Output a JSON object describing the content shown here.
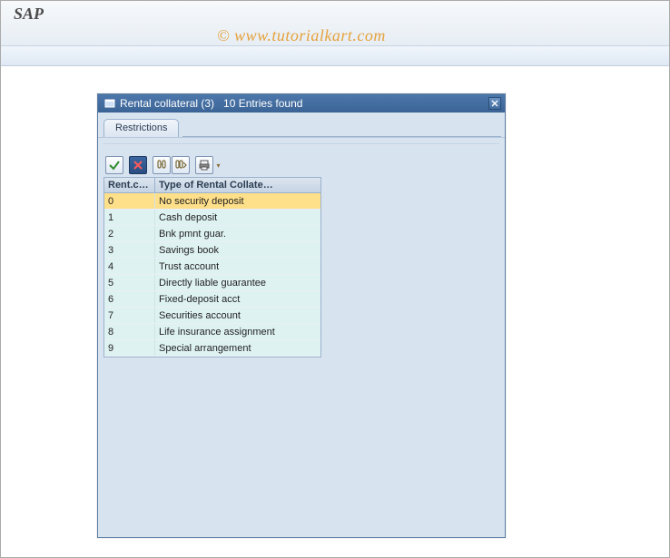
{
  "header": {
    "title": "SAP",
    "watermark": "© www.tutorialkart.com"
  },
  "dialog": {
    "title": "Rental collateral (3)",
    "subtitle": "10 Entries found",
    "close_label": "X",
    "tab_label": "Restrictions",
    "toolbar": {
      "accept": "accept",
      "cancel": "cancel",
      "find": "find",
      "find_next": "find-next",
      "print": "print"
    },
    "columns": {
      "code": "Rent.c…",
      "type": "Type of Rental Collate…"
    },
    "rows": [
      {
        "code": "0",
        "type": "No security deposit",
        "selected": true
      },
      {
        "code": "1",
        "type": "Cash deposit"
      },
      {
        "code": "2",
        "type": "Bnk pmnt guar."
      },
      {
        "code": "3",
        "type": "Savings book"
      },
      {
        "code": "4",
        "type": "Trust account"
      },
      {
        "code": "5",
        "type": "Directly liable guarantee"
      },
      {
        "code": "6",
        "type": "Fixed-deposit acct"
      },
      {
        "code": "7",
        "type": "Securities account"
      },
      {
        "code": "8",
        "type": "Life insurance assignment"
      },
      {
        "code": "9",
        "type": "Special arrangement"
      }
    ]
  }
}
